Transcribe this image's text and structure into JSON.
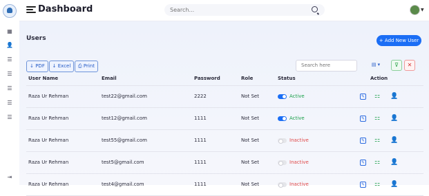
{
  "header": {
    "title": "Dashboard",
    "search_placeholder": "Search..."
  },
  "sidebar": {
    "icons": [
      "grid-icon",
      "user-plus-icon",
      "list-icon",
      "list-icon",
      "list-icon",
      "list-icon",
      "list-icon",
      "logout-icon"
    ]
  },
  "page": {
    "title": "Users",
    "add_button": "+ Add New User"
  },
  "toolbar": {
    "pdf": "↓ PDF",
    "excel": "↓ Excel",
    "print": "⎙ Print",
    "search_placeholder": "Search here"
  },
  "table": {
    "headers": {
      "name": "User Name",
      "email": "Email",
      "password": "Password",
      "role": "Role",
      "status": "Status",
      "action": "Action"
    },
    "rows": [
      {
        "name": "Raza Ur Rehman",
        "email": "test22@gmail.com",
        "password": "2222",
        "role": "Not Set",
        "status": "Active"
      },
      {
        "name": "Raza Ur Rehman",
        "email": "test12@gmail.com",
        "password": "1111",
        "role": "Not Set",
        "status": "Active"
      },
      {
        "name": "Raza Ur Rehman",
        "email": "test55@gmail.com",
        "password": "1111",
        "role": "Not Set",
        "status": "Inactive"
      },
      {
        "name": "Raza Ur Rehman",
        "email": "test5@gmail.com",
        "password": "1111",
        "role": "Not Set",
        "status": "Inactive"
      },
      {
        "name": "Raza Ur Rehman",
        "email": "test4@gmail.com",
        "password": "1111",
        "role": "Not Set",
        "status": "Inactive"
      }
    ]
  },
  "colors": {
    "accent": "#1b6ef5",
    "active": "#1aa04a",
    "inactive": "#e04848"
  }
}
